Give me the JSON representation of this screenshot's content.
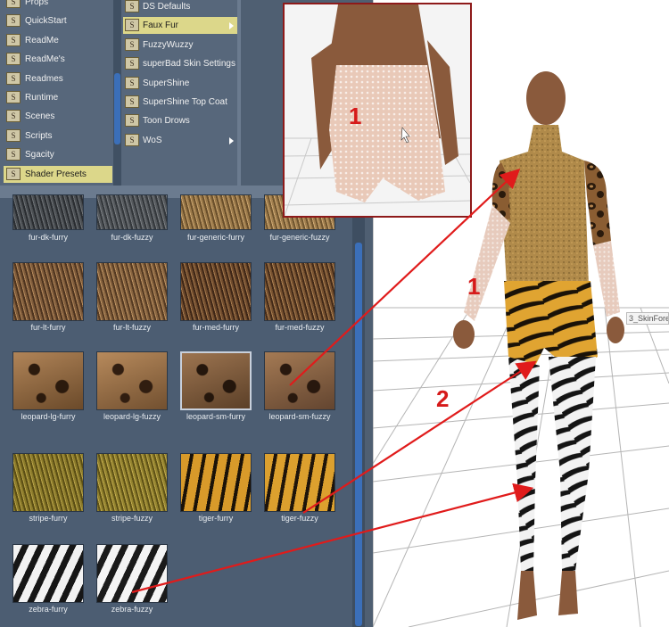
{
  "folders": [
    {
      "label": "Props"
    },
    {
      "label": "QuickStart"
    },
    {
      "label": "ReadMe"
    },
    {
      "label": "ReadMe's"
    },
    {
      "label": "Readmes"
    },
    {
      "label": "Runtime"
    },
    {
      "label": "Scenes"
    },
    {
      "label": "Scripts"
    },
    {
      "label": "Sgacity"
    },
    {
      "label": "Shader Presets",
      "selected": true
    }
  ],
  "presets": [
    {
      "label": "DS Defaults"
    },
    {
      "label": "Faux Fur",
      "selected": true,
      "submenu": true
    },
    {
      "label": "FuzzyWuzzy"
    },
    {
      "label": "superBad Skin Settings"
    },
    {
      "label": "SuperShine"
    },
    {
      "label": "SuperShine Top Coat"
    },
    {
      "label": "Toon Drows"
    },
    {
      "label": "WoS",
      "submenu": true
    }
  ],
  "swatches": [
    {
      "label": "fur-dk-furry",
      "colors": [
        "#4a4e52",
        "#2a2d31",
        "#6e7276"
      ]
    },
    {
      "label": "fur-dk-fuzzy",
      "colors": [
        "#54585c",
        "#33373b",
        "#7a7e82"
      ]
    },
    {
      "label": "fur-generic-furry",
      "colors": [
        "#9b7a4a",
        "#6a4f2b",
        "#c8a36e"
      ]
    },
    {
      "label": "fur-generic-fuzzy",
      "colors": [
        "#a07e4e",
        "#70552f",
        "#cfaa74"
      ]
    },
    {
      "label": "fur-lt-furry",
      "colors": [
        "#7d5a3a",
        "#4e341f",
        "#b58a5c"
      ]
    },
    {
      "label": "fur-lt-fuzzy",
      "colors": [
        "#86633f",
        "#553a22",
        "#bc9262"
      ]
    },
    {
      "label": "fur-med-furry",
      "colors": [
        "#6e4a2c",
        "#3e2616",
        "#a57a4e"
      ]
    },
    {
      "label": "fur-med-fuzzy",
      "colors": [
        "#75502f",
        "#432a18",
        "#ab8052"
      ]
    },
    {
      "label": "leopard-lg-furry",
      "colors": [
        "#6b4a2a",
        "#2b1a0d",
        "#b08458"
      ]
    },
    {
      "label": "leopard-lg-fuzzy",
      "colors": [
        "#725030",
        "#301d10",
        "#b78a5c"
      ]
    },
    {
      "label": "leopard-sm-furry",
      "colors": [
        "#5c4028",
        "#24160c",
        "#9c7450"
      ],
      "selected": true
    },
    {
      "label": "leopard-sm-fuzzy",
      "colors": [
        "#634530",
        "#28180e",
        "#a47a54"
      ]
    },
    {
      "label": "stripe-furry",
      "colors": [
        "#8a7a2a",
        "#5b4e14",
        "#b8a34a"
      ]
    },
    {
      "label": "stripe-fuzzy",
      "colors": [
        "#92822e",
        "#5f5216",
        "#c0aa4e"
      ]
    },
    {
      "label": "tiger-furry",
      "colors": [
        "#d89a2a",
        "#1a1208",
        "#eab246"
      ]
    },
    {
      "label": "tiger-fuzzy",
      "colors": [
        "#dca02e",
        "#1e140a",
        "#eeb84a"
      ]
    },
    {
      "label": "zebra-furry",
      "colors": [
        "#f2f2f2",
        "#161616",
        "#d0d0d0"
      ]
    },
    {
      "label": "zebra-fuzzy",
      "colors": [
        "#f4f4f4",
        "#1a1a1a",
        "#d4d4d4"
      ]
    }
  ],
  "callouts": {
    "inset_number": "1",
    "torso_number": "1",
    "legs_number": "2"
  },
  "viewport": {
    "skin_tag": "3_SkinFore"
  },
  "colors": {
    "accent_selected": "#dcd78a",
    "arrow": "#e01b1b",
    "panel": "#4f5f72",
    "scroll_thumb": "#3b6fb9"
  }
}
